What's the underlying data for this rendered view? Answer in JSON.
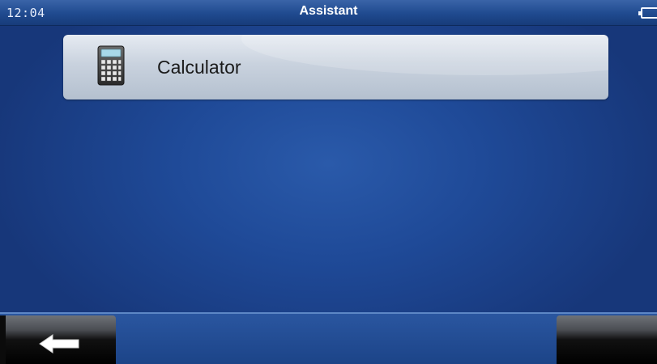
{
  "status_bar": {
    "time": "12:04",
    "title": "Assistant",
    "battery_icon": "battery-icon"
  },
  "list": {
    "items": [
      {
        "label": "Calculator",
        "icon": "calculator-icon"
      }
    ]
  },
  "bottom_bar": {
    "back_icon": "back-arrow-icon"
  },
  "colors": {
    "background": "#1f4a98",
    "item_background": "#c9d2de",
    "accent": "#5d87c6"
  }
}
